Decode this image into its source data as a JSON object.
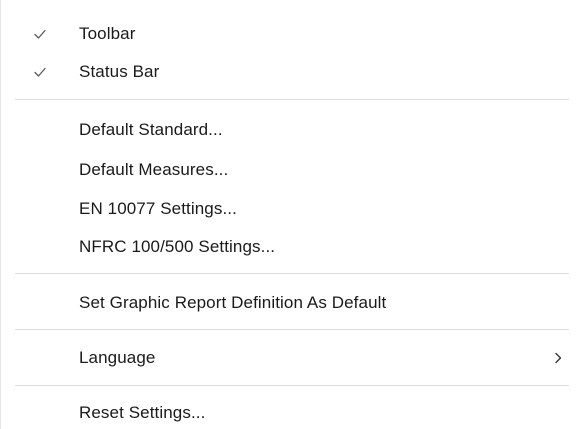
{
  "menu": {
    "items": [
      {
        "label": "Toolbar",
        "checked": true
      },
      {
        "label": "Status Bar",
        "checked": true
      },
      {
        "label": "Default Standard..."
      },
      {
        "label": "Default Measures..."
      },
      {
        "label": "EN 10077 Settings..."
      },
      {
        "label": "NFRC 100/500 Settings..."
      },
      {
        "label": "Set Graphic Report Definition As Default"
      },
      {
        "label": "Language",
        "submenu": true
      },
      {
        "label": "Reset Settings..."
      }
    ],
    "icons": {
      "check": "checkmark-icon",
      "submenu": "chevron-right-icon"
    },
    "colors": {
      "background": "#ffffff",
      "text": "#1a1a1a",
      "separator": "#dcdcdc",
      "check": "#5a5a5a"
    }
  }
}
